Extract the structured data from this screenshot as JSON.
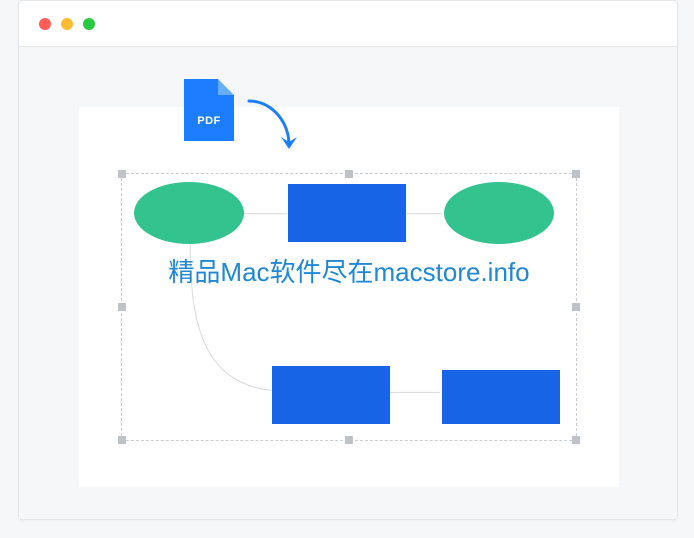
{
  "pdf": {
    "label": "PDF"
  },
  "overlay": {
    "text": "精品Mac软件尽在macstore.info"
  },
  "shapes": {
    "ellipse1": {
      "color": "#33c38f"
    },
    "rect1": {
      "color": "#1765e6"
    },
    "ellipse2": {
      "color": "#33c38f"
    },
    "rect2": {
      "color": "#1765e6"
    },
    "rect3": {
      "color": "#1765e6"
    }
  },
  "arrow": {
    "color": "#1c7eff"
  }
}
